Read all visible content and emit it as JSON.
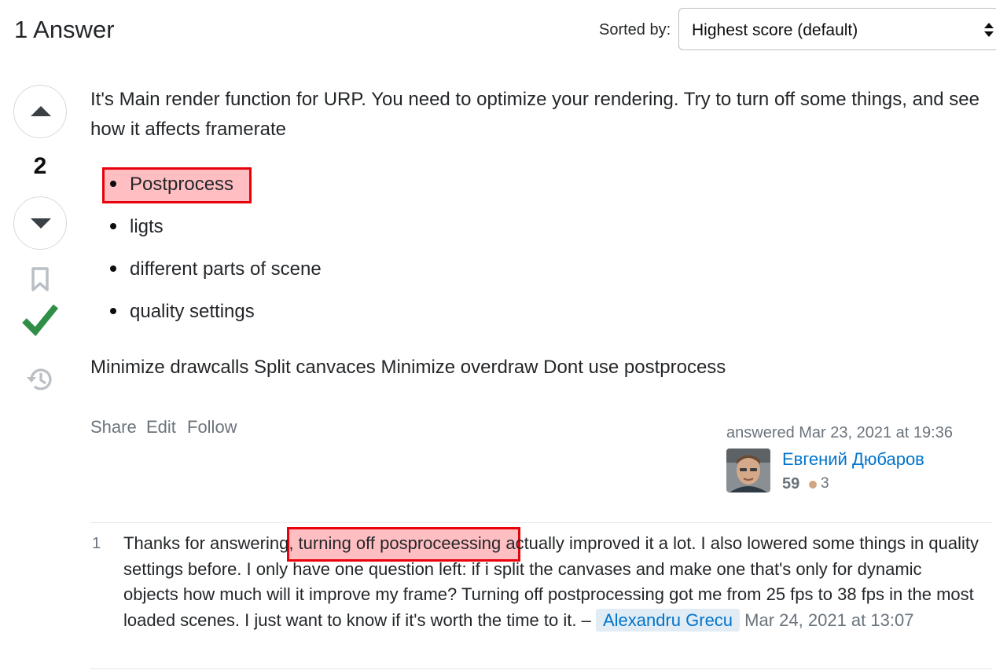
{
  "header": {
    "answers_count": "1 Answer",
    "sort_label": "Sorted by:",
    "sort_value": "Highest score (default)"
  },
  "vote": {
    "score": "2",
    "accepted": true
  },
  "answer": {
    "intro": "It's Main render function for URP. You need to optimize your rendering. Try to turn off some things, and see how it affects framerate",
    "bullets": [
      "Postprocess",
      "ligts",
      "different parts of scene",
      "quality settings"
    ],
    "tips": "Minimize drawcalls Split canvaces Minimize overdraw Dont use postprocess"
  },
  "actions": {
    "share": "Share",
    "edit": "Edit",
    "follow": "Follow"
  },
  "user_card": {
    "answered": "answered Mar 23, 2021 at 19:36",
    "name": "Евгений Дюбаров",
    "reputation": "59",
    "bronze_badges": "3"
  },
  "comment": {
    "score": "1",
    "text_before": "Thanks for answering",
    "text_highlight": ", turning off posproceessing",
    "text_after": " actually improved it a lot. I also lowered some things in quality settings before. I only have one question left: if i split the canvases and make one that's only for dynamic objects how much will it improve my frame? Turning off postprocessing got me from 25 fps to 38 fps in the most loaded scenes. I just want to know if it's worth the time to it. –",
    "user": "Alexandru Grecu",
    "date": "Mar 24, 2021 at 13:07"
  },
  "colors": {
    "link": "#0074cc",
    "accepted": "#2f8f46",
    "highlight_border": "#e8000b",
    "highlight_fill": "#ff6e78"
  },
  "icons": [
    "caret-up-icon",
    "caret-down-icon",
    "bookmark-icon",
    "checkmark-icon",
    "history-icon",
    "sort-arrows-icon"
  ]
}
